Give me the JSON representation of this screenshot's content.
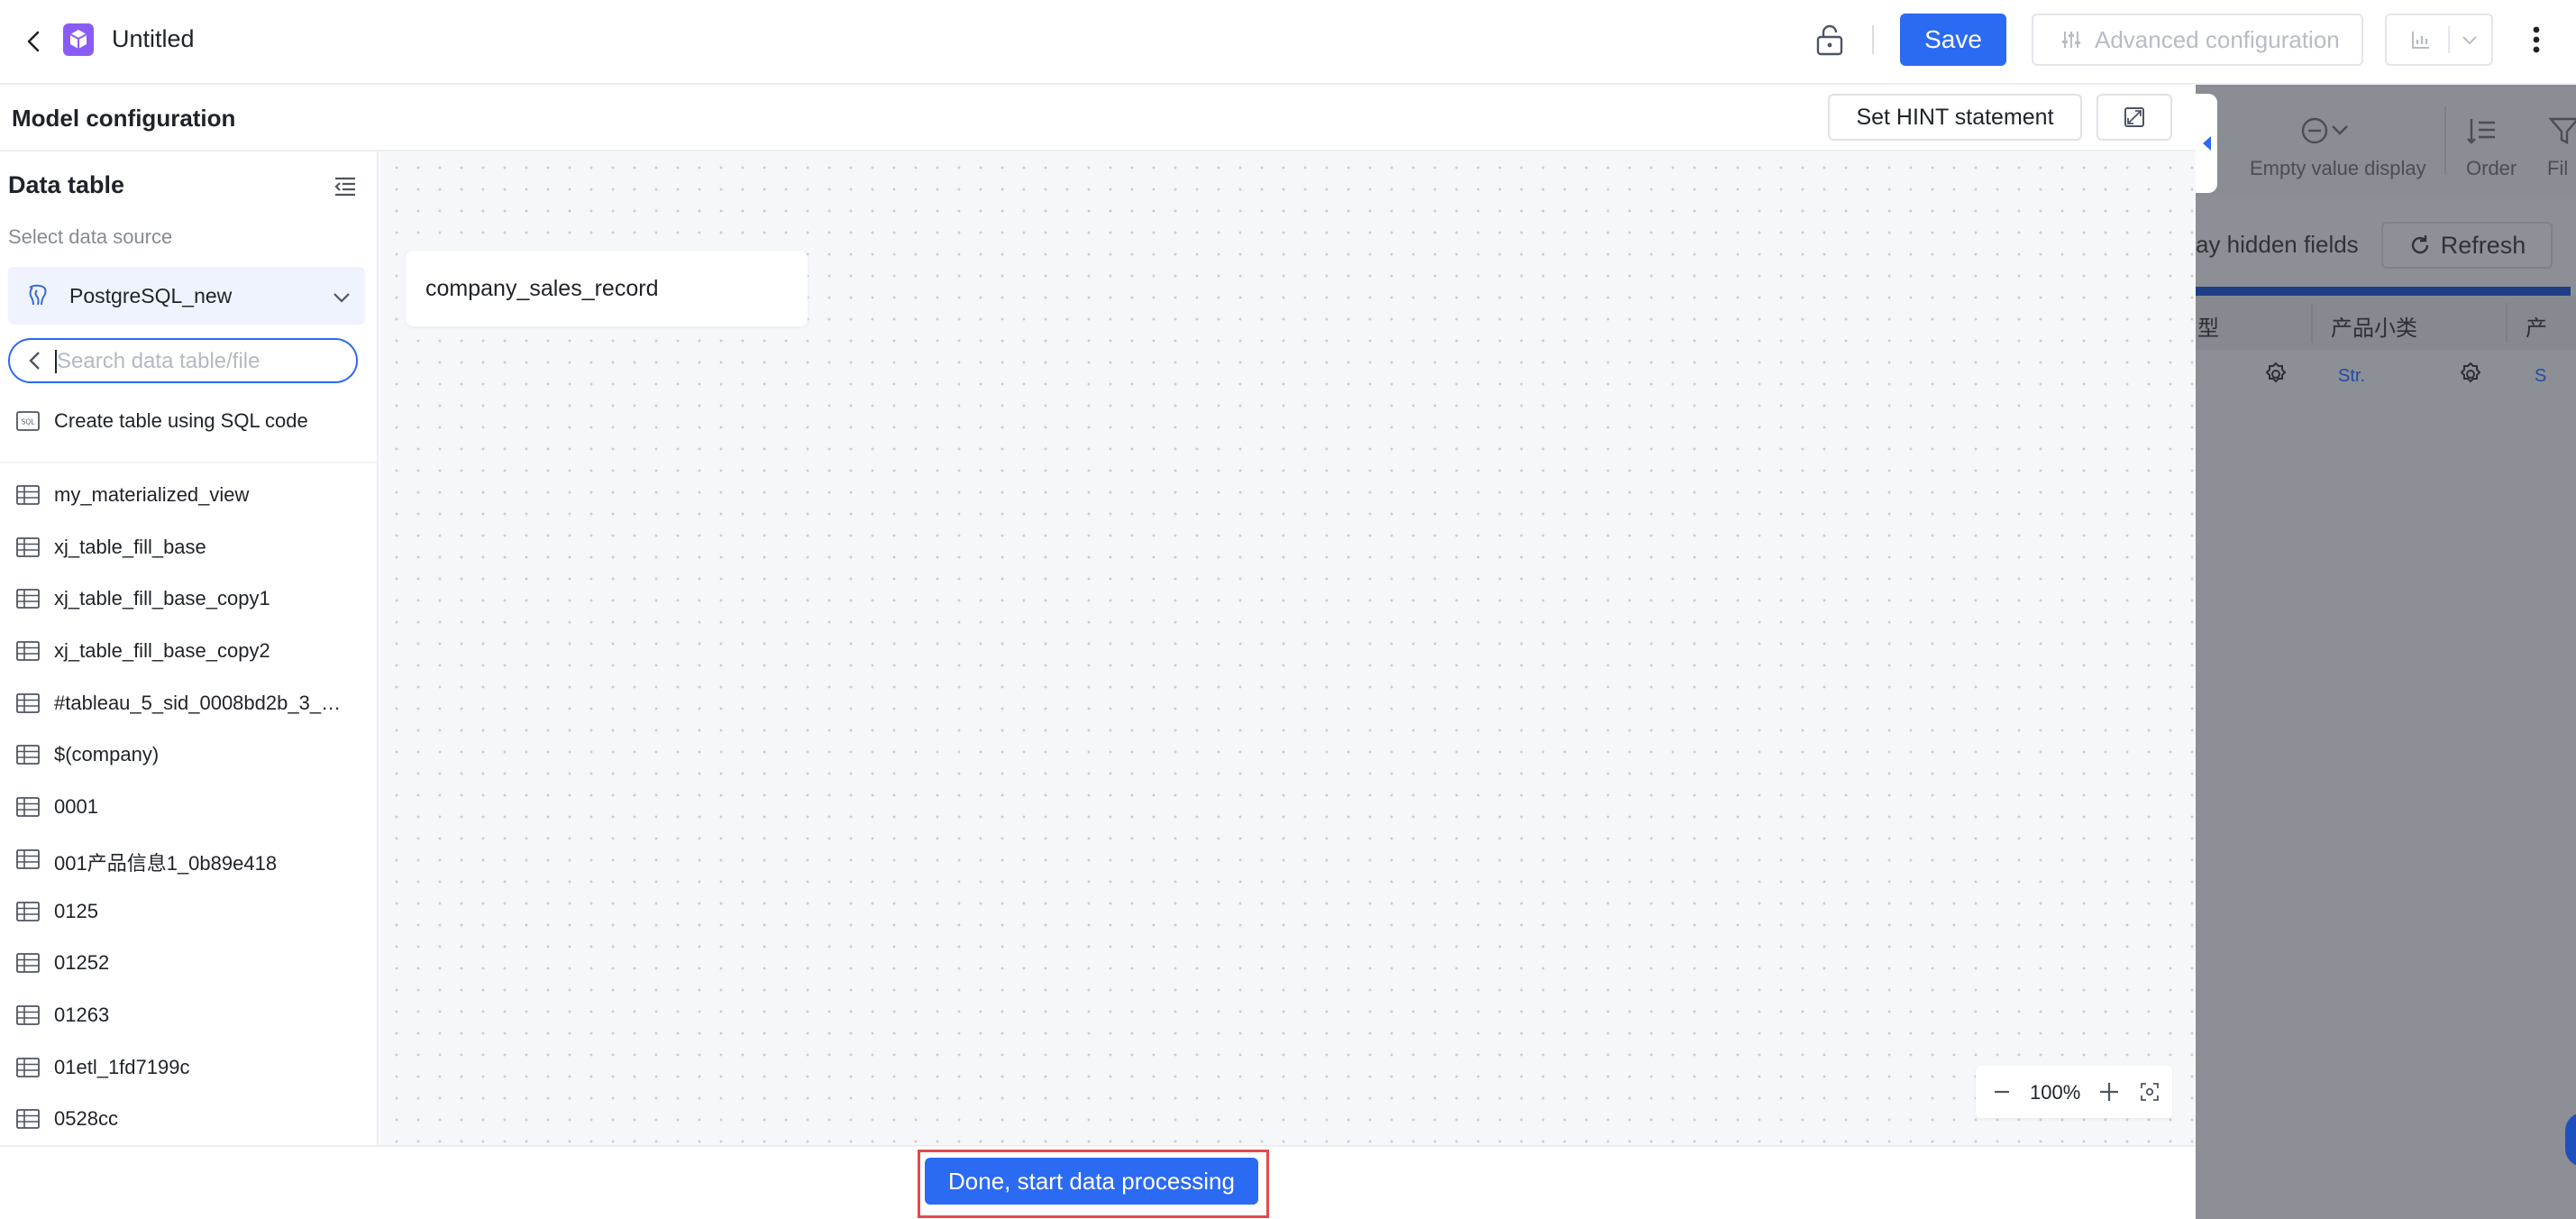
{
  "header": {
    "title": "Untitled",
    "save_label": "Save",
    "advanced_label": "Advanced configuration"
  },
  "model_config": {
    "title": "Model configuration",
    "hint_button": "Set HINT statement"
  },
  "sidebar": {
    "title": "Data table",
    "datasource_label": "Select data source",
    "datasource_value": "PostgreSQL_new",
    "search_placeholder": "Search data table/file",
    "sql_item": "Create table using SQL code",
    "tables": [
      "my_materialized_view",
      "xj_table_fill_base",
      "xj_table_fill_base_copy1",
      "xj_table_fill_base_copy2",
      "#tableau_5_sid_0008bd2b_3_c...",
      "$(company)",
      "0001",
      "001产品信息1_0b89e418",
      "0125",
      "01252",
      "01263",
      "01etl_1fd7199c",
      "0528cc"
    ]
  },
  "canvas": {
    "node_label": "company_sales_record",
    "zoom_level": "100%"
  },
  "right_panel": {
    "empty_value_label": "Empty value display",
    "order_label": "Order",
    "filter_label": "Fil",
    "hidden_fields_label": "ay hidden fields",
    "refresh_label": "Refresh",
    "columns": [
      "型",
      "产品小类",
      "产"
    ],
    "type_badge_1": "Str.",
    "type_badge_2": "S"
  },
  "footer": {
    "done_label": "Done, start data processing"
  },
  "colors": {
    "primary": "#2b6af3",
    "highlight_frame": "#e5484d",
    "overlay": "#8c8f95"
  }
}
